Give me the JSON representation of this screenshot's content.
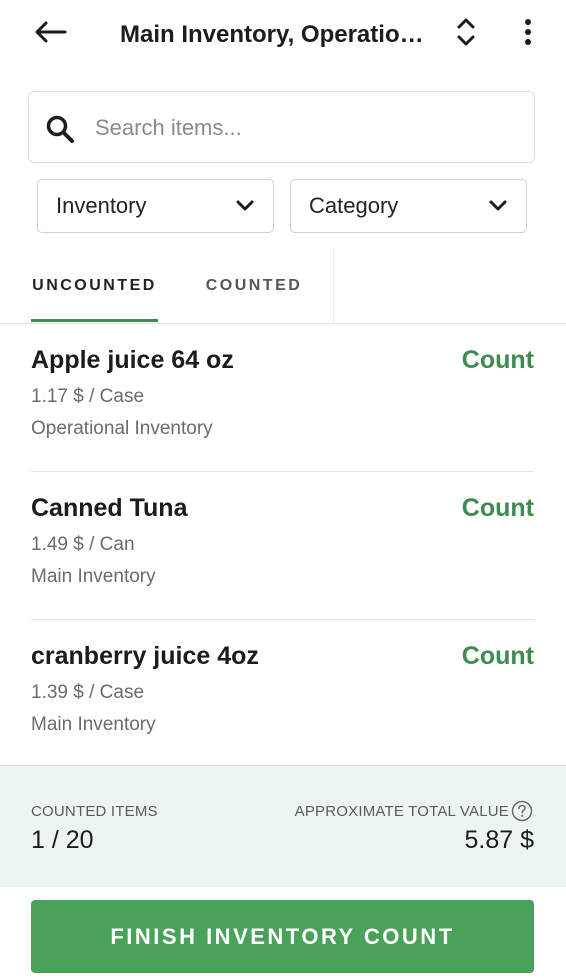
{
  "header": {
    "title": "Main Inventory, Operational Inventory",
    "back_icon": "arrow-left-icon",
    "switch_icon": "unfold-icon",
    "more_icon": "more-vertical-icon"
  },
  "search": {
    "placeholder": "Search items...",
    "value": "",
    "icon": "search-icon"
  },
  "filters": {
    "inventory_label": "Inventory",
    "category_label": "Category"
  },
  "tabs": {
    "uncounted": "UNCOUNTED",
    "counted": "COUNTED",
    "active": "uncounted"
  },
  "items": [
    {
      "name": "Apple juice 64 oz",
      "price": "1.17 $ / Case",
      "location": "Operational Inventory",
      "action": "Count"
    },
    {
      "name": "Canned Tuna",
      "price": "1.49 $ / Can",
      "location": "Main Inventory",
      "action": "Count"
    },
    {
      "name": "cranberry juice 4oz",
      "price": "1.39 $ / Case",
      "location": "Main Inventory",
      "action": "Count"
    }
  ],
  "summary": {
    "counted_label": "COUNTED ITEMS",
    "counted_value": "1 / 20",
    "total_label": "APPROXIMATE TOTAL VALUE",
    "total_value": "5.87 $",
    "help_icon": "help-circle-icon"
  },
  "footer": {
    "finish_label": "FINISH INVENTORY COUNT"
  },
  "colors": {
    "accent": "#3d8b4e",
    "button": "#4aa25a",
    "summary_bg": "#edf6ee"
  }
}
